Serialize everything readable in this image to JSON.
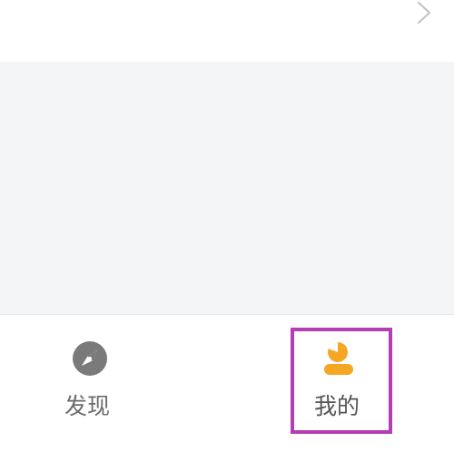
{
  "top_row": {
    "chevron_icon": "chevron-right-icon"
  },
  "tabbar": {
    "tabs": [
      {
        "label": "发现",
        "icon": "compass-icon",
        "color": "#7a7a7a",
        "active": false
      },
      {
        "label": "我的",
        "icon": "person-icon",
        "color": "#f5a623",
        "active": true
      }
    ]
  },
  "colors": {
    "accent": "#f5a623",
    "highlight": "#b43cb4",
    "background_gray": "#f4f5f7"
  }
}
